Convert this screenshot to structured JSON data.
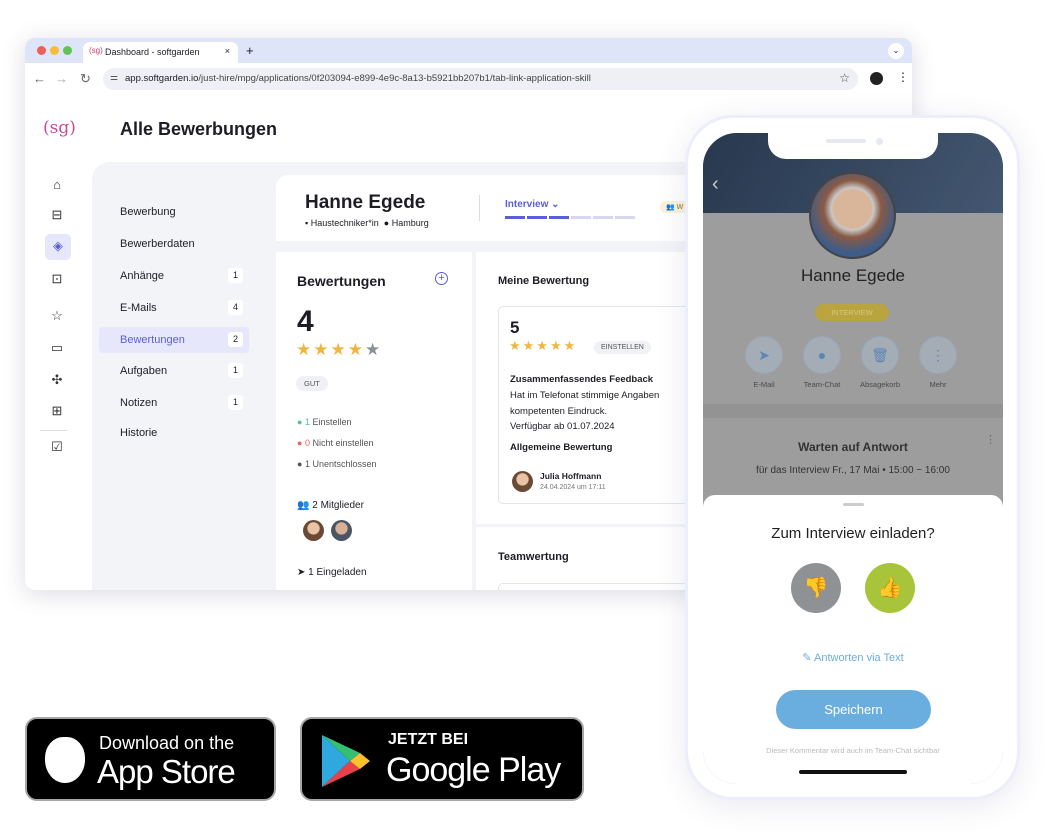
{
  "browser": {
    "tab_title": "Dashboard - softgarden",
    "url_host": "app.softgarden.io",
    "url_path": "/just-hire/mpg/applications/0f203094-e899-4e9c-8a13-b5921bb207b1/tab-link-application-skill",
    "new_tab": "+",
    "close": "×"
  },
  "app": {
    "logo": "(sg)",
    "page_title": "Alle Bewerbungen"
  },
  "rail": [
    "home-icon",
    "briefcase-icon",
    "layers-icon",
    "presentation-icon",
    "star-icon",
    "quote-chat-icon",
    "puzzle-icon",
    "store-icon",
    "checkbox-icon"
  ],
  "sidenav": [
    {
      "label": "Bewerbung",
      "count": ""
    },
    {
      "label": "Bewerberdaten",
      "count": ""
    },
    {
      "label": "Anhänge",
      "count": "1"
    },
    {
      "label": "E-Mails",
      "count": "4"
    },
    {
      "label": "Bewertungen",
      "count": "2",
      "active": true
    },
    {
      "label": "Aufgaben",
      "count": "1"
    },
    {
      "label": "Notizen",
      "count": "1"
    },
    {
      "label": "Historie",
      "count": ""
    }
  ],
  "candidate": {
    "name": "Hanne Egede",
    "job": "Haustechniker*in",
    "location": "Hamburg",
    "stage": "Interview",
    "stage_progress": "3/6",
    "tag": "W"
  },
  "ratings": {
    "title": "Bewertungen",
    "score": "4",
    "stars": 4,
    "label": "GUT",
    "votes": [
      {
        "count": "1",
        "label": "Einstellen",
        "color": "#4fc39a"
      },
      {
        "count": "0",
        "label": "Nicht einstellen",
        "color": "#e0685f"
      },
      {
        "count": "1",
        "label": "Unentschlossen",
        "color": "#555"
      }
    ],
    "members": "2 Mitglieder",
    "invited": "1 Eingeladen"
  },
  "my_rating": {
    "title": "Meine Bewertung",
    "score": "5",
    "stars": 5,
    "decision": "EINSTELLEN",
    "feedback_title": "Zusammenfassendes Feedback",
    "feedback_line1": "Hat im Telefonat stimmige Angaben",
    "feedback_line2": "kompetenten Eindruck.",
    "feedback_line3": "Verfügbar ab 01.07.2024",
    "general_title": "Allgemeine Bewertung",
    "author": "Julia Hoffmann",
    "date": "24.04.2024 um 17:11"
  },
  "team": {
    "title": "Teamwertung"
  },
  "phone": {
    "name": "Hanne Egede",
    "status": "INTERVIEW",
    "actions": [
      "E-Mail",
      "Team-Chat",
      "Absagekorb",
      "Mehr"
    ],
    "waiting_title": "Warten auf Antwort",
    "waiting_sub": "für das Interview Fr., 17 Mai • 15:00 ~ 16:00",
    "sheet_title": "Zum Interview einladen?",
    "reply_text": "Antworten via Text",
    "save": "Speichern",
    "hint": "Dieser Kommentar wird auch im Team-Chat sichtbar"
  },
  "stores": {
    "apple_small": "Download on the",
    "apple_big": "App Store",
    "google_small": "JETZT BEI",
    "google_big": "Google Play"
  },
  "colors": {
    "accent": "#5a5fd8",
    "star": "#f0b541",
    "thumb_up": "#a8c43a",
    "save": "#6aaee0"
  }
}
